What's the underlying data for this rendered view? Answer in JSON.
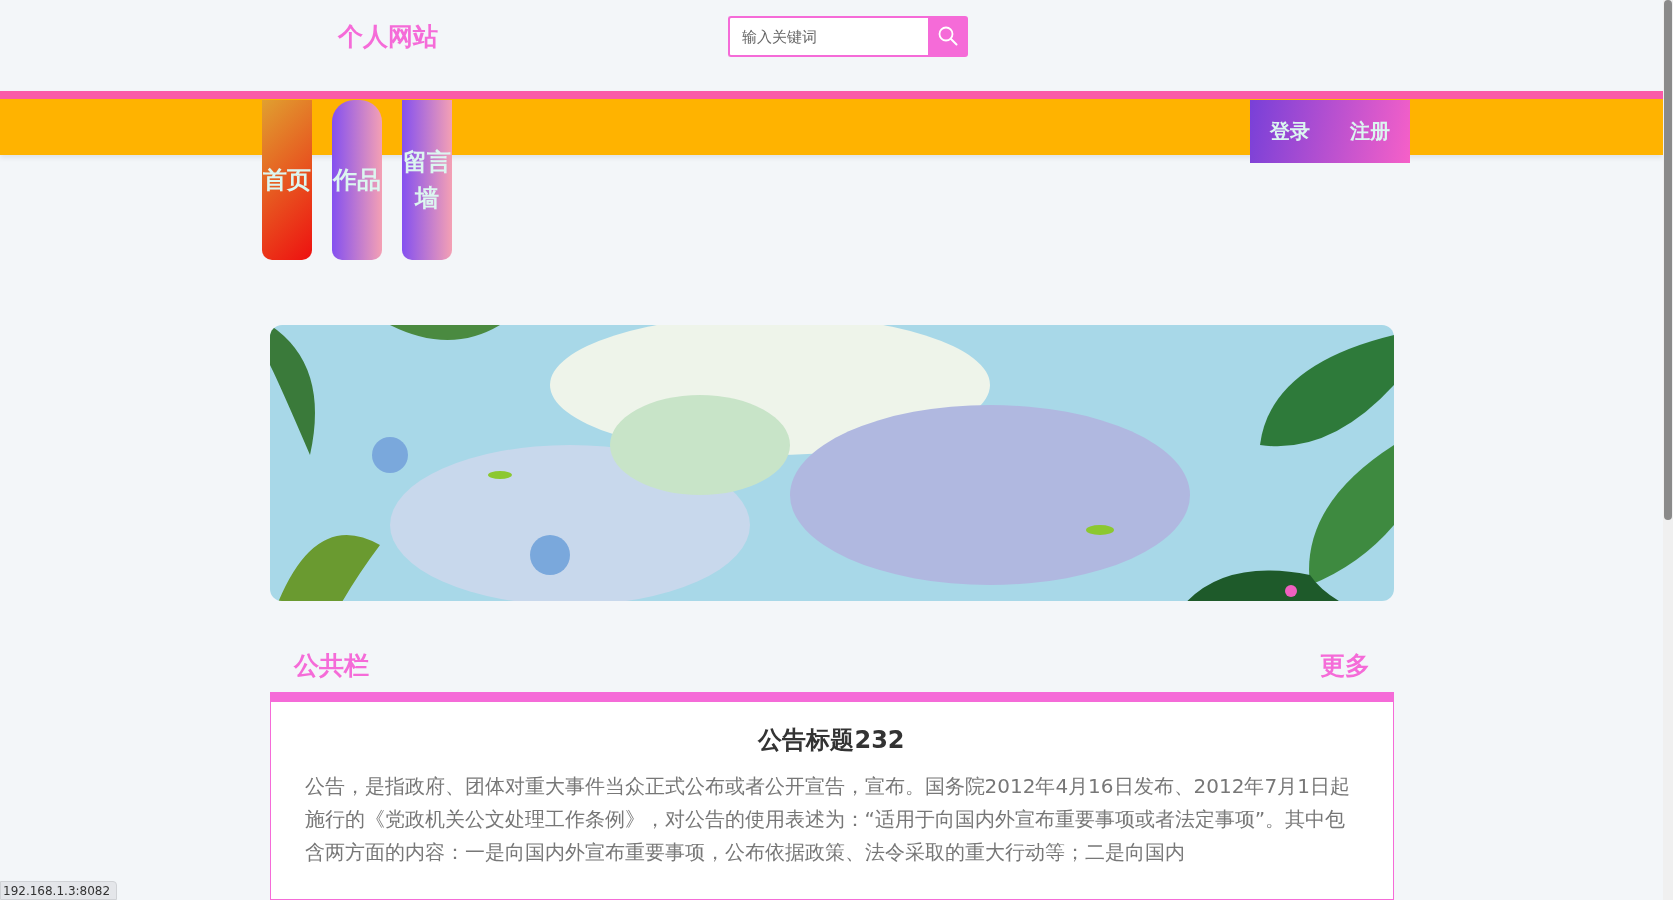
{
  "site": {
    "logo": "个人网站"
  },
  "search": {
    "placeholder": "输入关键词"
  },
  "nav": {
    "items": [
      {
        "label": "首页",
        "kind": "warm"
      },
      {
        "label": "作品",
        "kind": "cool"
      },
      {
        "label": "留言墙",
        "kind": "cool"
      }
    ],
    "auth": [
      {
        "label": "登录"
      },
      {
        "label": "注册"
      }
    ]
  },
  "notice": {
    "title": "公共栏",
    "more": "更多",
    "item": {
      "title": "公告标题232",
      "body": "公告，是指政府、团体对重大事件当众正式公布或者公开宣告，宣布。国务院2012年4月16日发布、2012年7月1日起施行的《党政机关公文处理工作条例》，对公告的使用表述为：“适用于向国内外宣布重要事项或者法定事项”。其中包含两方面的内容：一是向国内外宣布重要事项，公布依据政策、法令采取的重大行动等；二是向国内"
    }
  },
  "status_url": "192.168.1.3:8082"
}
